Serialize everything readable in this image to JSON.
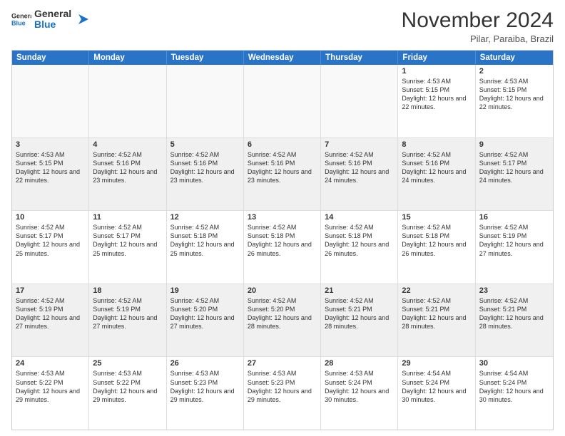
{
  "logo": {
    "general": "General",
    "blue": "Blue"
  },
  "header": {
    "month": "November 2024",
    "location": "Pilar, Paraiba, Brazil"
  },
  "days_of_week": [
    "Sunday",
    "Monday",
    "Tuesday",
    "Wednesday",
    "Thursday",
    "Friday",
    "Saturday"
  ],
  "weeks": [
    [
      {
        "day": "",
        "empty": true
      },
      {
        "day": "",
        "empty": true
      },
      {
        "day": "",
        "empty": true
      },
      {
        "day": "",
        "empty": true
      },
      {
        "day": "",
        "empty": true
      },
      {
        "day": "1",
        "sunrise": "4:53 AM",
        "sunset": "5:15 PM",
        "daylight": "12 hours and 22 minutes."
      },
      {
        "day": "2",
        "sunrise": "4:53 AM",
        "sunset": "5:15 PM",
        "daylight": "12 hours and 22 minutes."
      }
    ],
    [
      {
        "day": "3",
        "sunrise": "4:53 AM",
        "sunset": "5:15 PM",
        "daylight": "12 hours and 22 minutes."
      },
      {
        "day": "4",
        "sunrise": "4:52 AM",
        "sunset": "5:16 PM",
        "daylight": "12 hours and 23 minutes."
      },
      {
        "day": "5",
        "sunrise": "4:52 AM",
        "sunset": "5:16 PM",
        "daylight": "12 hours and 23 minutes."
      },
      {
        "day": "6",
        "sunrise": "4:52 AM",
        "sunset": "5:16 PM",
        "daylight": "12 hours and 23 minutes."
      },
      {
        "day": "7",
        "sunrise": "4:52 AM",
        "sunset": "5:16 PM",
        "daylight": "12 hours and 24 minutes."
      },
      {
        "day": "8",
        "sunrise": "4:52 AM",
        "sunset": "5:16 PM",
        "daylight": "12 hours and 24 minutes."
      },
      {
        "day": "9",
        "sunrise": "4:52 AM",
        "sunset": "5:17 PM",
        "daylight": "12 hours and 24 minutes."
      }
    ],
    [
      {
        "day": "10",
        "sunrise": "4:52 AM",
        "sunset": "5:17 PM",
        "daylight": "12 hours and 25 minutes."
      },
      {
        "day": "11",
        "sunrise": "4:52 AM",
        "sunset": "5:17 PM",
        "daylight": "12 hours and 25 minutes."
      },
      {
        "day": "12",
        "sunrise": "4:52 AM",
        "sunset": "5:18 PM",
        "daylight": "12 hours and 25 minutes."
      },
      {
        "day": "13",
        "sunrise": "4:52 AM",
        "sunset": "5:18 PM",
        "daylight": "12 hours and 26 minutes."
      },
      {
        "day": "14",
        "sunrise": "4:52 AM",
        "sunset": "5:18 PM",
        "daylight": "12 hours and 26 minutes."
      },
      {
        "day": "15",
        "sunrise": "4:52 AM",
        "sunset": "5:18 PM",
        "daylight": "12 hours and 26 minutes."
      },
      {
        "day": "16",
        "sunrise": "4:52 AM",
        "sunset": "5:19 PM",
        "daylight": "12 hours and 27 minutes."
      }
    ],
    [
      {
        "day": "17",
        "sunrise": "4:52 AM",
        "sunset": "5:19 PM",
        "daylight": "12 hours and 27 minutes."
      },
      {
        "day": "18",
        "sunrise": "4:52 AM",
        "sunset": "5:19 PM",
        "daylight": "12 hours and 27 minutes."
      },
      {
        "day": "19",
        "sunrise": "4:52 AM",
        "sunset": "5:20 PM",
        "daylight": "12 hours and 27 minutes."
      },
      {
        "day": "20",
        "sunrise": "4:52 AM",
        "sunset": "5:20 PM",
        "daylight": "12 hours and 28 minutes."
      },
      {
        "day": "21",
        "sunrise": "4:52 AM",
        "sunset": "5:21 PM",
        "daylight": "12 hours and 28 minutes."
      },
      {
        "day": "22",
        "sunrise": "4:52 AM",
        "sunset": "5:21 PM",
        "daylight": "12 hours and 28 minutes."
      },
      {
        "day": "23",
        "sunrise": "4:52 AM",
        "sunset": "5:21 PM",
        "daylight": "12 hours and 28 minutes."
      }
    ],
    [
      {
        "day": "24",
        "sunrise": "4:53 AM",
        "sunset": "5:22 PM",
        "daylight": "12 hours and 29 minutes."
      },
      {
        "day": "25",
        "sunrise": "4:53 AM",
        "sunset": "5:22 PM",
        "daylight": "12 hours and 29 minutes."
      },
      {
        "day": "26",
        "sunrise": "4:53 AM",
        "sunset": "5:23 PM",
        "daylight": "12 hours and 29 minutes."
      },
      {
        "day": "27",
        "sunrise": "4:53 AM",
        "sunset": "5:23 PM",
        "daylight": "12 hours and 29 minutes."
      },
      {
        "day": "28",
        "sunrise": "4:53 AM",
        "sunset": "5:24 PM",
        "daylight": "12 hours and 30 minutes."
      },
      {
        "day": "29",
        "sunrise": "4:54 AM",
        "sunset": "5:24 PM",
        "daylight": "12 hours and 30 minutes."
      },
      {
        "day": "30",
        "sunrise": "4:54 AM",
        "sunset": "5:24 PM",
        "daylight": "12 hours and 30 minutes."
      }
    ]
  ]
}
